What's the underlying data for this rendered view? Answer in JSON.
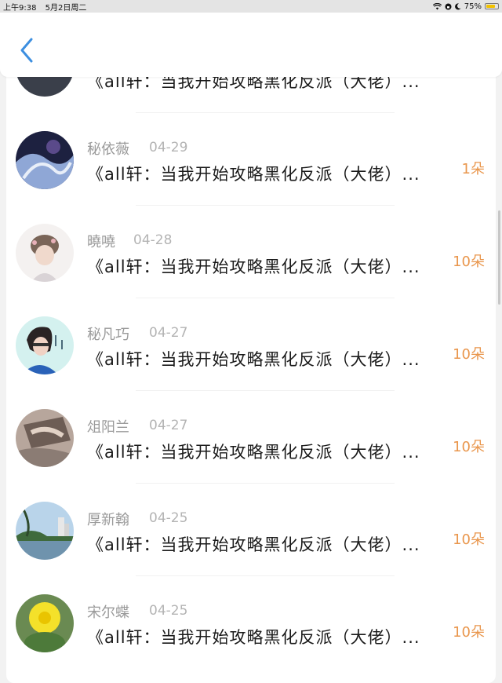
{
  "status_bar": {
    "time": "上午9:38",
    "date": "5月2日周二",
    "battery": "75%"
  },
  "nav": {
    "back_icon": "chevron-left-icon",
    "accent": "#3d8fe0"
  },
  "list": {
    "partial_row": {
      "title": "《all轩：当我开始攻略黑化反派（大佬）..."
    },
    "rows": [
      {
        "name": "秘依薇",
        "date": "04-29",
        "title": "《all轩：当我开始攻略黑化反派（大佬）...",
        "gift": "1朵"
      },
      {
        "name": "曉嘵",
        "date": "04-28",
        "title": "《all轩：当我开始攻略黑化反派（大佬）...",
        "gift": "10朵"
      },
      {
        "name": "秘凡巧",
        "date": "04-27",
        "title": "《all轩：当我开始攻略黑化反派（大佬）...",
        "gift": "10朵"
      },
      {
        "name": "俎阳兰",
        "date": "04-27",
        "title": "《all轩：当我开始攻略黑化反派（大佬）...",
        "gift": "10朵"
      },
      {
        "name": "厚新翰",
        "date": "04-25",
        "title": "《all轩：当我开始攻略黑化反派（大佬）...",
        "gift": "10朵"
      },
      {
        "name": "宋尔蝶",
        "date": "04-25",
        "title": "《all轩：当我开始攻略黑化反派（大佬）...",
        "gift": "10朵"
      }
    ]
  },
  "colors": {
    "gift": "#e9964c",
    "name": "#9a9a9a",
    "title": "#1a1a1a"
  }
}
